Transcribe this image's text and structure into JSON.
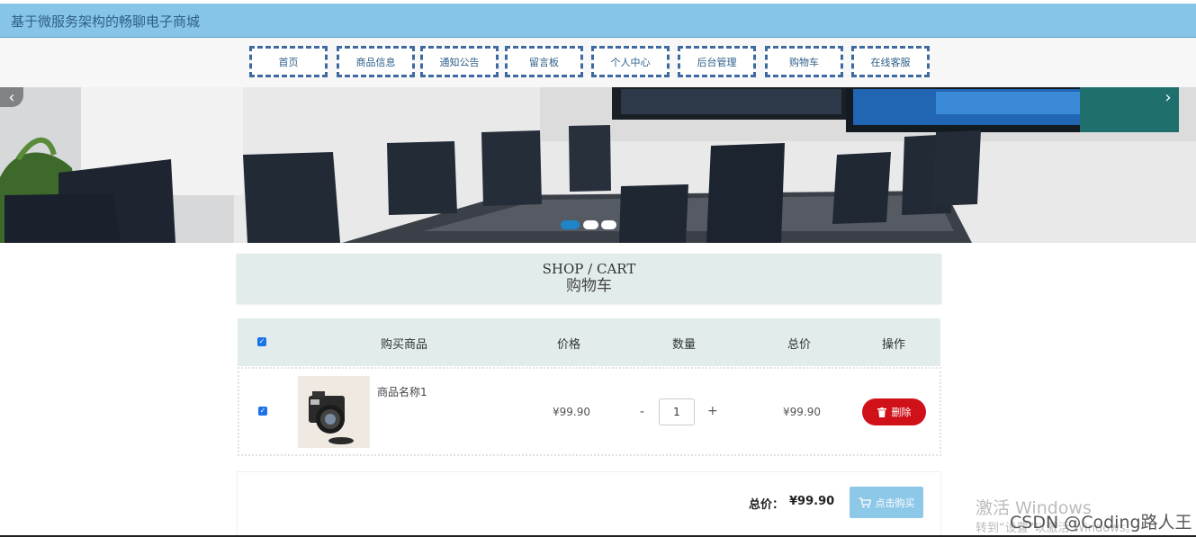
{
  "site": {
    "title": "基于微服务架构的畅聊电子商城"
  },
  "nav": {
    "items": [
      {
        "label": "首页"
      },
      {
        "label": "商品信息"
      },
      {
        "label": "通知公告"
      },
      {
        "label": "留言板"
      },
      {
        "label": "个人中心"
      },
      {
        "label": "后台管理"
      },
      {
        "label": "购物车"
      },
      {
        "label": "在线客服"
      }
    ]
  },
  "banner": {
    "prev_icon": "‹",
    "next_icon": "›",
    "active_slide": 1,
    "slide_count": 3
  },
  "cart": {
    "title_en": "SHOP / CART",
    "title_cn": "购物车",
    "columns": {
      "product": "购买商品",
      "price": "价格",
      "quantity": "数量",
      "total": "总价",
      "action": "操作"
    },
    "items": [
      {
        "name": "商品名称1",
        "price": "¥99.90",
        "quantity": "1",
        "subtotal": "¥99.90",
        "delete_label": "删除",
        "checked": true
      }
    ],
    "minus": "-",
    "plus": "+",
    "total_label": "总价：",
    "total_value": "¥99.90",
    "buy_label": "点击购买"
  },
  "overlay": {
    "windows_line1": "激活 Windows",
    "windows_line2": "转到“设置”以激活 Windows。",
    "csdn": "CSDN @Coding路人王"
  },
  "colors": {
    "accent": "#87c5e6",
    "delete": "#d0111a",
    "buy": "#8ec8e8",
    "header_bg": "#e2eced"
  }
}
